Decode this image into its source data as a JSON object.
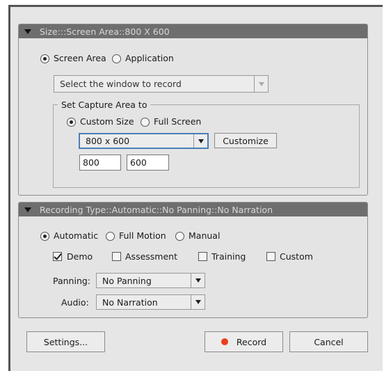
{
  "size_panel": {
    "header": "Size:::Screen Area::800 X 600",
    "mode_screen_area": "Screen Area",
    "mode_application": "Application",
    "window_select": "Select the window to record",
    "capture_group_title": "Set Capture Area to",
    "custom_size": "Custom Size",
    "full_screen": "Full Screen",
    "size_select": "800 x 600",
    "customize_label": "Customize",
    "width_value": "800",
    "height_value": "600"
  },
  "recording_panel": {
    "header": "Recording Type::Automatic::No Panning::No Narration",
    "automatic": "Automatic",
    "full_motion": "Full Motion",
    "manual": "Manual",
    "demo": "Demo",
    "assessment": "Assessment",
    "training": "Training",
    "custom": "Custom",
    "panning_label": "Panning:",
    "panning_value": "No Panning",
    "audio_label": "Audio:",
    "audio_value": "No Narration"
  },
  "footer": {
    "settings_label": "Settings...",
    "record_label": "Record",
    "cancel_label": "Cancel"
  },
  "colors": {
    "header_bg": "#6e6e6e",
    "record_dot": "#e8401c",
    "focus_border": "#4a7fb5"
  }
}
